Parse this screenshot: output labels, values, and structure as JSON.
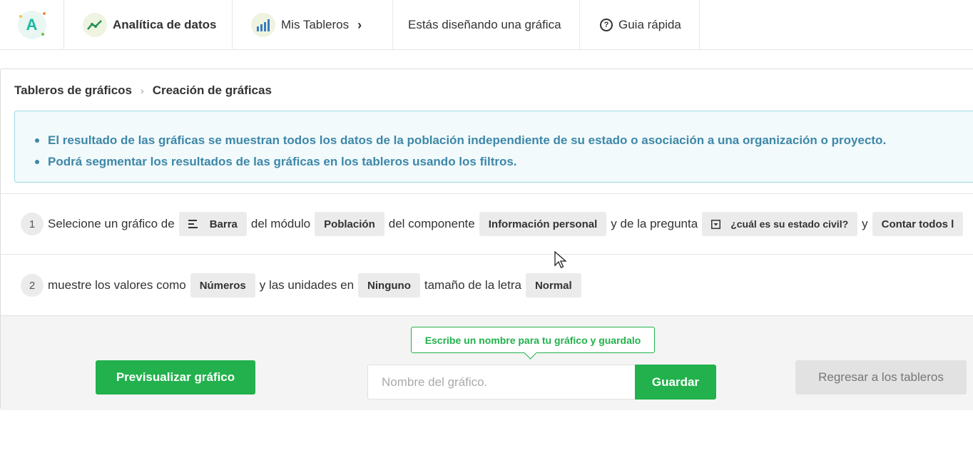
{
  "topnav": {
    "logo_letter": "A",
    "analitica": "Analítica de datos",
    "tableros": "Mis Tableros",
    "disenando": "Estás diseñando una gráfica",
    "guia": "Guia rápida"
  },
  "breadcrumb": {
    "item1": "Tableros de gráficos",
    "item2": "Creación de gráficas"
  },
  "info": {
    "line1": "El resultado de las gráficas se muestran todos los datos de la población independiente de su estado o asociación a una organización o proyecto.",
    "line2": "Podrá segmentar los resultados de las gráficas en los tableros usando los filtros."
  },
  "step1": {
    "num": "1",
    "t1": "Selecione un gráfico de",
    "chart_type": "Barra",
    "t2": "del módulo",
    "module": "Población",
    "t3": "del componente",
    "component": "Información personal",
    "t4": "y de la pregunta",
    "question": "¿cuál es su estado civil?",
    "t5": "y",
    "aggregation": "Contar todos l"
  },
  "step2": {
    "num": "2",
    "t1": "muestre los valores como",
    "values_as": "Números",
    "t2": "y las unidades en",
    "units": "Ninguno",
    "t3": "tamaño de la letra",
    "font_size": "Normal"
  },
  "footer": {
    "preview": "Previsualizar gráfico",
    "tooltip": "Escribe un nombre para tu gráfico y guardalo",
    "name_placeholder": "Nombre del gráfico.",
    "save": "Guardar",
    "back": "Regresar a los tableros"
  },
  "colors": {
    "green": "#22b14c",
    "info_text": "#3d87a8",
    "info_border": "#9fd8e2"
  }
}
